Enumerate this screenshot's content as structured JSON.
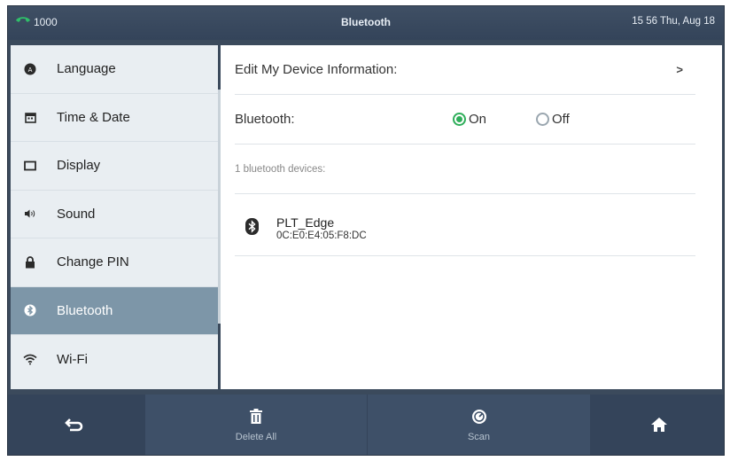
{
  "status_bar": {
    "line_number": "1000",
    "title": "Bluetooth",
    "datetime": "15 56 Thu, Aug 18"
  },
  "sidebar": {
    "items": [
      {
        "label": "Language",
        "icon": "language-icon"
      },
      {
        "label": "Time & Date",
        "icon": "calendar-icon"
      },
      {
        "label": "Display",
        "icon": "display-icon"
      },
      {
        "label": "Sound",
        "icon": "speaker-icon"
      },
      {
        "label": "Change PIN",
        "icon": "lock-icon"
      },
      {
        "label": "Bluetooth",
        "icon": "bluetooth-icon",
        "active": true
      },
      {
        "label": "Wi-Fi",
        "icon": "wifi-icon"
      }
    ]
  },
  "main": {
    "edit_device_label": "Edit My Device Information:",
    "edit_device_chevron": ">",
    "bluetooth_label": "Bluetooth:",
    "radio_on": "On",
    "radio_off": "Off",
    "selected": "On",
    "devices_count_label": "1 bluetooth devices:",
    "devices": [
      {
        "name": "PLT_Edge",
        "mac": "0C:E0:E4:05:F8:DC"
      }
    ]
  },
  "softkeys": {
    "back_icon": "back-arrow-icon",
    "delete_all": "Delete All",
    "scan": "Scan",
    "home_icon": "home-icon"
  },
  "colors": {
    "frame": "#3b4a5c",
    "sidebar_bg": "#e9eef2",
    "active_item": "#7d96a8",
    "radio_on": "#2fae5a",
    "phone_icon": "#2fbf6a"
  }
}
